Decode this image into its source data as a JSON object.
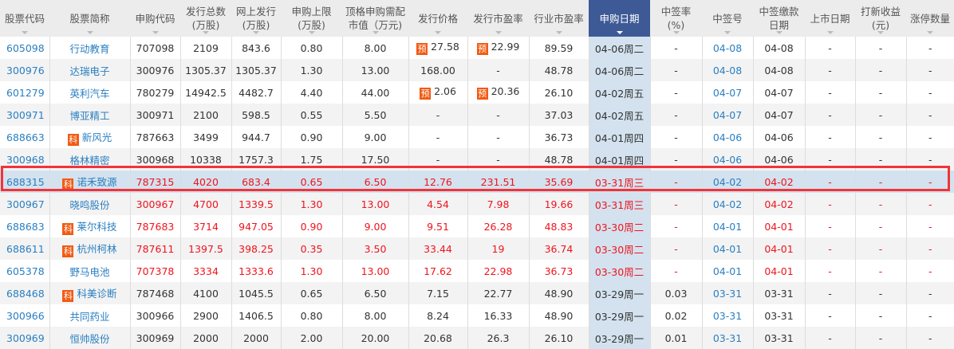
{
  "headers": [
    "股票代码",
    "股票简称",
    "申购代码",
    "发行总数\n(万股)",
    "网上发行\n(万股)",
    "申购上限\n(万股)",
    "顶格申购需配\n市值（万元)",
    "发行价格",
    "发行市盈率",
    "行业市盈率",
    "申购日期",
    "中签率\n(%)",
    "中签号",
    "中签缴款\n日期",
    "上市日期",
    "打新收益\n(元)",
    "涨停数量"
  ],
  "badges": {
    "star": "科",
    "pre": "预"
  },
  "colors": {
    "accent": "#3d5a96",
    "red": "#f0141e",
    "link": "#2a7fc1",
    "highlight": "#f2333a"
  },
  "rows": [
    {
      "code": "605098",
      "name": "行动教育",
      "star": false,
      "sub": "707098",
      "total": "2109",
      "online": "843.6",
      "limit": "0.80",
      "cap": "8.00",
      "price": "27.58",
      "price_pre": true,
      "pe": "22.99",
      "pe_pre": true,
      "ipe": "89.59",
      "date": "04-06周二",
      "rate": "-",
      "sign": "04-08",
      "pay": "04-08",
      "list": "-",
      "profit": "-",
      "up": "-",
      "red": false
    },
    {
      "code": "300976",
      "name": "达瑞电子",
      "star": false,
      "sub": "300976",
      "total": "1305.37",
      "online": "1305.37",
      "limit": "1.30",
      "cap": "13.00",
      "price": "168.00",
      "price_pre": false,
      "pe": "-",
      "pe_pre": false,
      "ipe": "48.78",
      "date": "04-06周二",
      "rate": "-",
      "sign": "04-08",
      "pay": "04-08",
      "list": "-",
      "profit": "-",
      "up": "-",
      "red": false
    },
    {
      "code": "601279",
      "name": "英利汽车",
      "star": false,
      "sub": "780279",
      "total": "14942.5",
      "online": "4482.7",
      "limit": "4.40",
      "cap": "44.00",
      "price": "2.06",
      "price_pre": true,
      "pe": "20.36",
      "pe_pre": true,
      "ipe": "26.10",
      "date": "04-02周五",
      "rate": "-",
      "sign": "04-07",
      "pay": "04-07",
      "list": "-",
      "profit": "-",
      "up": "-",
      "red": false
    },
    {
      "code": "300971",
      "name": "博亚精工",
      "star": false,
      "sub": "300971",
      "total": "2100",
      "online": "598.5",
      "limit": "0.55",
      "cap": "5.50",
      "price": "-",
      "price_pre": false,
      "pe": "-",
      "pe_pre": false,
      "ipe": "37.03",
      "date": "04-02周五",
      "rate": "-",
      "sign": "04-07",
      "pay": "04-07",
      "list": "-",
      "profit": "-",
      "up": "-",
      "red": false
    },
    {
      "code": "688663",
      "name": "新风光",
      "star": true,
      "sub": "787663",
      "total": "3499",
      "online": "944.7",
      "limit": "0.90",
      "cap": "9.00",
      "price": "-",
      "price_pre": false,
      "pe": "-",
      "pe_pre": false,
      "ipe": "36.73",
      "date": "04-01周四",
      "rate": "-",
      "sign": "04-06",
      "pay": "04-06",
      "list": "-",
      "profit": "-",
      "up": "-",
      "red": false
    },
    {
      "code": "300968",
      "name": "格林精密",
      "star": false,
      "sub": "300968",
      "total": "10338",
      "online": "1757.3",
      "limit": "1.75",
      "cap": "17.50",
      "price": "-",
      "price_pre": false,
      "pe": "-",
      "pe_pre": false,
      "ipe": "48.78",
      "date": "04-01周四",
      "rate": "-",
      "sign": "04-06",
      "pay": "04-06",
      "list": "-",
      "profit": "-",
      "up": "-",
      "red": false
    },
    {
      "code": "688315",
      "name": "诺禾致源",
      "star": true,
      "sub": "787315",
      "total": "4020",
      "online": "683.4",
      "limit": "0.65",
      "cap": "6.50",
      "price": "12.76",
      "price_pre": false,
      "pe": "231.51",
      "pe_pre": false,
      "ipe": "35.69",
      "date": "03-31周三",
      "rate": "-",
      "sign": "04-02",
      "pay": "04-02",
      "list": "-",
      "profit": "-",
      "up": "-",
      "red": true
    },
    {
      "code": "300967",
      "name": "晓鸣股份",
      "star": false,
      "sub": "300967",
      "total": "4700",
      "online": "1339.5",
      "limit": "1.30",
      "cap": "13.00",
      "price": "4.54",
      "price_pre": false,
      "pe": "7.98",
      "pe_pre": false,
      "ipe": "19.66",
      "date": "03-31周三",
      "rate": "-",
      "sign": "04-02",
      "pay": "04-02",
      "list": "-",
      "profit": "-",
      "up": "-",
      "red": true
    },
    {
      "code": "688683",
      "name": "莱尔科技",
      "star": true,
      "sub": "787683",
      "total": "3714",
      "online": "947.05",
      "limit": "0.90",
      "cap": "9.00",
      "price": "9.51",
      "price_pre": false,
      "pe": "26.28",
      "pe_pre": false,
      "ipe": "48.83",
      "date": "03-30周二",
      "rate": "-",
      "sign": "04-01",
      "pay": "04-01",
      "list": "-",
      "profit": "-",
      "up": "-",
      "red": true
    },
    {
      "code": "688611",
      "name": "杭州柯林",
      "star": true,
      "sub": "787611",
      "total": "1397.5",
      "online": "398.25",
      "limit": "0.35",
      "cap": "3.50",
      "price": "33.44",
      "price_pre": false,
      "pe": "19",
      "pe_pre": false,
      "ipe": "36.74",
      "date": "03-30周二",
      "rate": "-",
      "sign": "04-01",
      "pay": "04-01",
      "list": "-",
      "profit": "-",
      "up": "-",
      "red": true
    },
    {
      "code": "605378",
      "name": "野马电池",
      "star": false,
      "sub": "707378",
      "total": "3334",
      "online": "1333.6",
      "limit": "1.30",
      "cap": "13.00",
      "price": "17.62",
      "price_pre": false,
      "pe": "22.98",
      "pe_pre": false,
      "ipe": "36.73",
      "date": "03-30周二",
      "rate": "-",
      "sign": "04-01",
      "pay": "04-01",
      "list": "-",
      "profit": "-",
      "up": "-",
      "red": true
    },
    {
      "code": "688468",
      "name": "科美诊断",
      "star": true,
      "sub": "787468",
      "total": "4100",
      "online": "1045.5",
      "limit": "0.65",
      "cap": "6.50",
      "price": "7.15",
      "price_pre": false,
      "pe": "22.77",
      "pe_pre": false,
      "ipe": "48.90",
      "date": "03-29周一",
      "rate": "0.03",
      "sign": "03-31",
      "pay": "03-31",
      "list": "-",
      "profit": "-",
      "up": "-",
      "red": false
    },
    {
      "code": "300966",
      "name": "共同药业",
      "star": false,
      "sub": "300966",
      "total": "2900",
      "online": "1406.5",
      "limit": "0.80",
      "cap": "8.00",
      "price": "8.24",
      "price_pre": false,
      "pe": "16.33",
      "pe_pre": false,
      "ipe": "48.90",
      "date": "03-29周一",
      "rate": "0.02",
      "sign": "03-31",
      "pay": "03-31",
      "list": "-",
      "profit": "-",
      "up": "-",
      "red": false
    },
    {
      "code": "300969",
      "name": "恒帅股份",
      "star": false,
      "sub": "300969",
      "total": "2000",
      "online": "2000",
      "limit": "2.00",
      "cap": "20.00",
      "price": "20.68",
      "price_pre": false,
      "pe": "26.3",
      "pe_pre": false,
      "ipe": "26.10",
      "date": "03-29周一",
      "rate": "0.01",
      "sign": "03-31",
      "pay": "03-31",
      "list": "-",
      "profit": "-",
      "up": "-",
      "red": false
    }
  ]
}
